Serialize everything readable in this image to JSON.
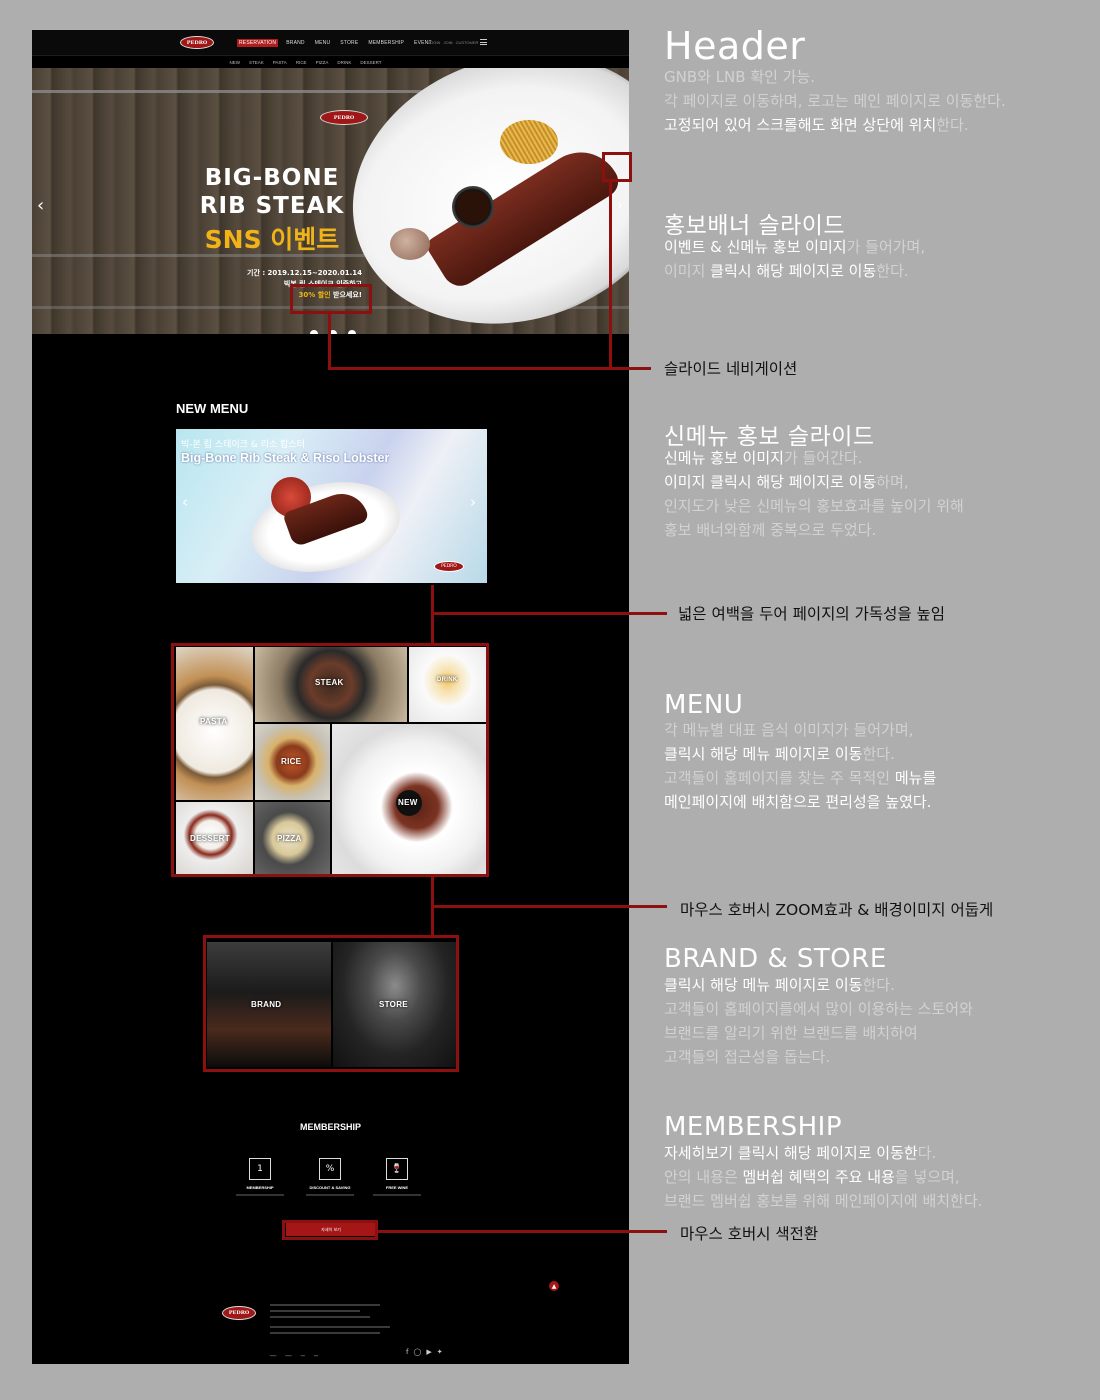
{
  "site": {
    "brand": "PEDRO",
    "gnb": [
      "RESERVATION",
      "BRAND",
      "MENU",
      "STORE",
      "MEMBERSHIP",
      "EVENT"
    ],
    "util": [
      "LOGIN",
      "JOIN",
      "CUSTOMER"
    ],
    "lnb": [
      "NEW",
      "STEAK",
      "PASTA",
      "RICE",
      "PIZZA",
      "DRINK",
      "DESSERT"
    ],
    "hero": {
      "title_line1": "BIG-BONE",
      "title_line2": "RIB STEAK",
      "event": "SNS 이벤트",
      "period": "기간 : 2019.12.15~2020.01.14",
      "line2": "빅본 립 스테이크 인증하고",
      "discount": "30% 할인",
      "line3_suffix": " 받으세요!"
    },
    "new_menu": {
      "title": "NEW MENU",
      "ko": "빅-본 립 스테이크 & 리소 랍스터",
      "en": "Big-Bone Rib Steak & Riso Lobster"
    },
    "menu_grid": [
      "PASTA",
      "STEAK",
      "DRINK",
      "RICE",
      "NEW",
      "DESSERT",
      "PIZZA"
    ],
    "brand_store": [
      "BRAND",
      "STORE"
    ],
    "membership": {
      "title": "MEMBERSHIP",
      "items": [
        "MEMBERSHIP",
        "DISCOUNT & SAVING",
        "FREE WINE"
      ],
      "button": "자세히 보기"
    }
  },
  "annotations": {
    "header": {
      "title": "Header",
      "l1": "GNB와 LNB 확인 가능.",
      "l2": "각 페이지로 이동하며, 로고는 메인 페이지로 이동한다.",
      "l3a": "고정되어 있어 스크롤해도 화면 상단에 위치",
      "l3b": "한다."
    },
    "promo": {
      "title": "홍보배너 슬라이드",
      "l1a": "이벤트 & 신메뉴 홍보 이미지",
      "l1b": "가 들어가며,",
      "l2a": "이미지 ",
      "l2b": "클릭시 해당 페이지로 이동",
      "l2c": "한다."
    },
    "slide_nav": "슬라이드 네비게이션",
    "new_menu": {
      "title": "신메뉴 홍보 슬라이드",
      "l1a": "신메뉴 홍보 이미지",
      "l1b": "가 들어간다.",
      "l2a": "이미지 클릭시 해당 페이지로 이동",
      "l2b": "하며,",
      "l3": "인지도가 낮은 신메뉴의 홍보효과를 높이기 위해",
      "l4": "홍보 배너와함께 중복으로 두었다."
    },
    "whitespace": "넓은 여백을 두어 페이지의 가독성을 높임",
    "menu": {
      "title": "MENU",
      "l1": "각 메뉴별 대표 음식 이미지가 들어가며,",
      "l2a": "클릭시 해당 메뉴 페이지로 이동",
      "l2b": "한다.",
      "l3a": "고객들이 홈페이지를 찾는 주 목적인 ",
      "l3b": "메뉴를",
      "l4": "메인페이지에 배치함으로 편리성을 높였다."
    },
    "hover_zoom": "마우스 호버시 ZOOM효과 & 배경이미지 어둡게",
    "brand_store": {
      "title": "BRAND & STORE",
      "l1a": "클릭시 해당 메뉴 페이지로 이동",
      "l1b": "한다.",
      "l2": "고객들이 홈페이지를에서 많이 이용하는 스토어와",
      "l3": "브랜드를 알리기 위한 브랜드를 배치하여",
      "l4": "고객들의 접근성을 돕는다."
    },
    "membership": {
      "title": "MEMBERSHIP",
      "l1a": "자세히보기 클릭시 해당 페이지로 이동한",
      "l1b": "다.",
      "l2a": "안의 내용은 ",
      "l2b": "멤버쉽 혜택의 주요 내용",
      "l2c": "을 넣으며,",
      "l3": "브랜드 멤버쉽 홍보를 위해 메인페이지에 배치한다."
    },
    "hover_color": "마우스 호버시 색전환"
  }
}
